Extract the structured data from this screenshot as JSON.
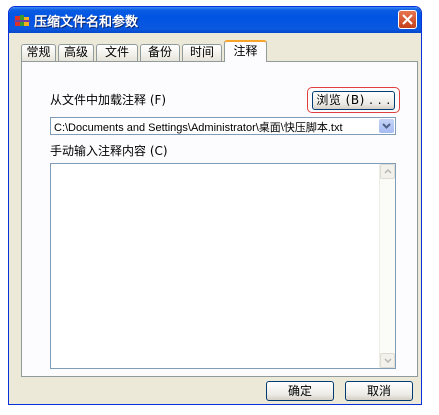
{
  "window": {
    "title": "压缩文件名和参数"
  },
  "tabs": [
    {
      "label": "常规"
    },
    {
      "label": "高级"
    },
    {
      "label": "文件"
    },
    {
      "label": "备份"
    },
    {
      "label": "时间"
    },
    {
      "label": "注释"
    }
  ],
  "active_tab": "注释",
  "comment": {
    "from_file_label": "从文件中加载注释 (F)",
    "browse_label": "浏览 (B) . . .",
    "file_path": "C:\\Documents and Settings\\Administrator\\桌面\\快压脚本.txt",
    "manual_label": "手动输入注释内容 (C)",
    "manual_value": ""
  },
  "buttons": {
    "ok": "确定",
    "cancel": "取消"
  },
  "colors": {
    "titlebar": "#0054e3",
    "active_tab_accent": "#f7a62b",
    "highlight": "#e04040",
    "dialog_bg": "#ece9d8"
  },
  "icons": {
    "app": "winrar-style-archive-icon",
    "close": "close-icon",
    "dropdown": "chevron-down-icon"
  }
}
